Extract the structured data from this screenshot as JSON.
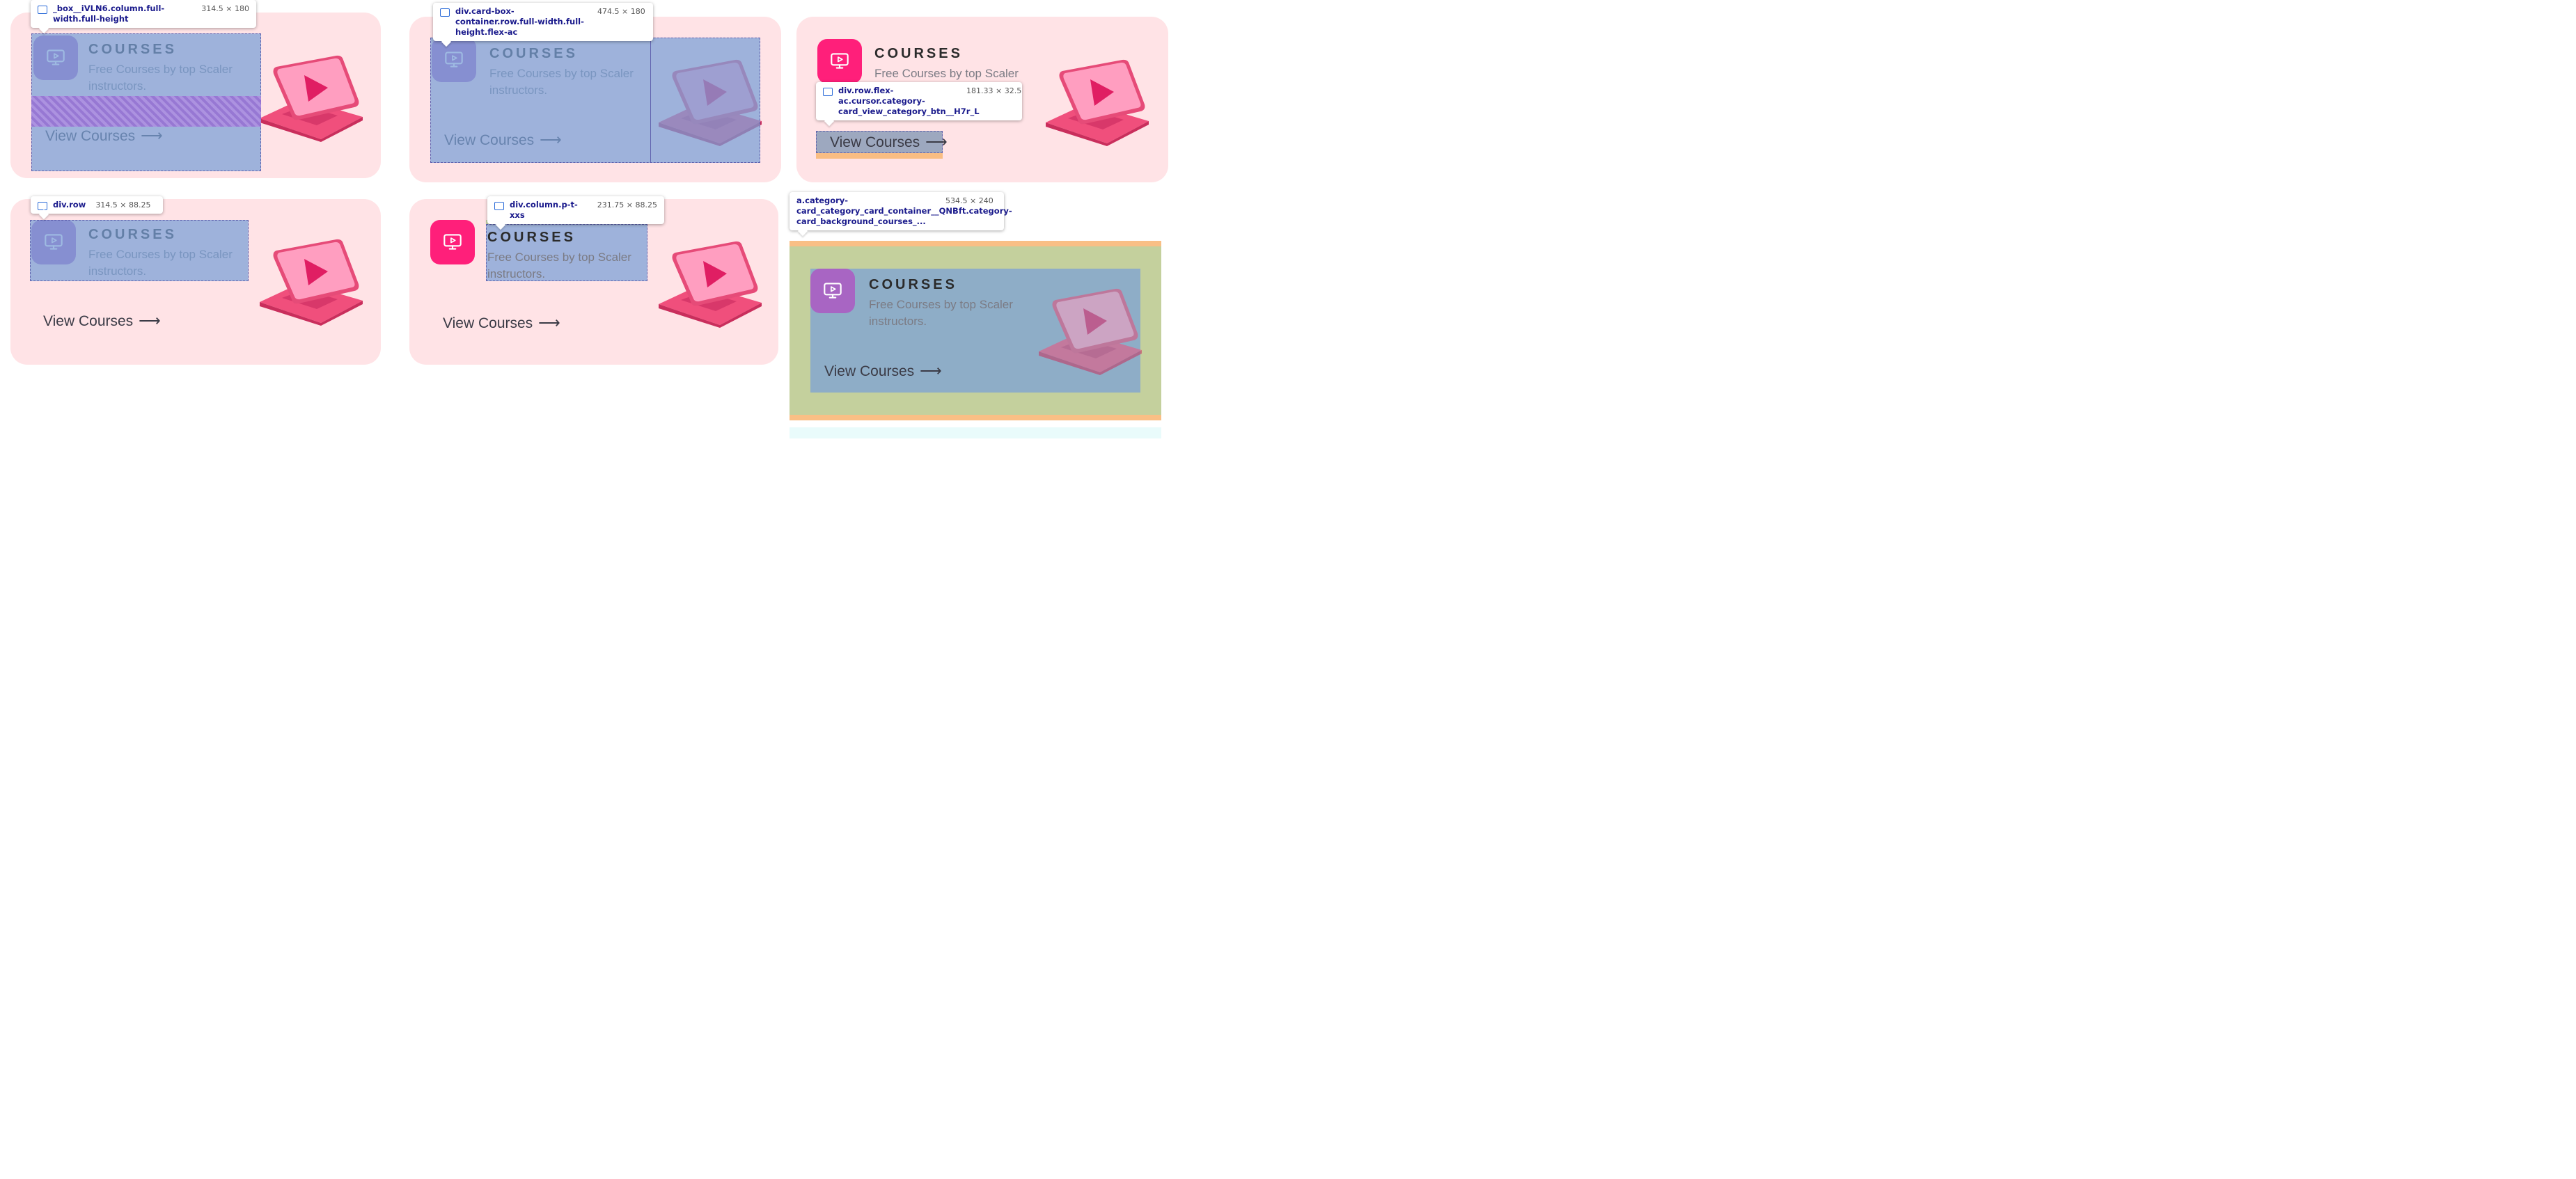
{
  "card": {
    "title": "COURSES",
    "subtitle": "Free Courses by top Scaler instructors.",
    "cta": "View Courses",
    "cta_arrow": "⟶"
  },
  "tooltips": {
    "t1": {
      "name": "_box__iVLN6.column.full-width.full-height",
      "size": "314.5 × 180"
    },
    "t2": {
      "name": "div.card-box-container.row.full-width.full-height.flex-ac",
      "size": "474.5 × 180"
    },
    "t3": {
      "name": "div.row.flex-ac.cursor.category-card_view_category_btn__H7r_L",
      "size": "181.33 × 32.5"
    },
    "t4": {
      "name": "div.row",
      "size": "314.5 × 88.25"
    },
    "t5": {
      "name": "div.column.p-t-xxs",
      "size": "231.75 × 88.25"
    },
    "t6": {
      "name": "a.category-card_category_card_container__QNBft.category-card_background_courses_...",
      "size": "534.5 × 240"
    }
  },
  "colors": {
    "card_bg": "#ffe3e6",
    "icon_accent": "#ff1f7a",
    "highlight_blue": "#78a0d7",
    "highlight_orange": "#f8b878",
    "highlight_green": "#bed2a0"
  },
  "icons": {
    "course": "play-monitor-icon",
    "illustration": "laptop-play-illustration"
  }
}
